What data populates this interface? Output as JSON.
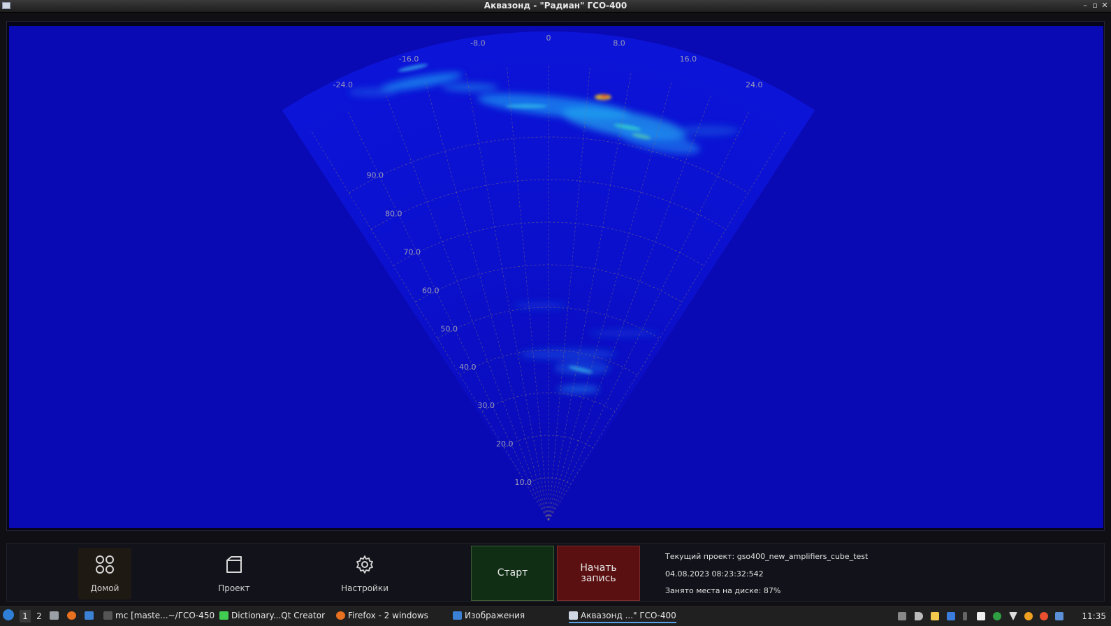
{
  "window": {
    "title": "Аквазонд  - \"Радиан\" ГСО-400"
  },
  "sonar": {
    "bearing_labels": [
      "-24.0",
      "-16.0",
      "-8.0",
      "0",
      "8.0",
      "16.0",
      "24.0"
    ],
    "range_labels": [
      "10.0",
      "20.0",
      "30.0",
      "40.0",
      "50.0",
      "60.0",
      "70.0",
      "80.0",
      "90.0"
    ],
    "colors": {
      "background": "#0a0ab4",
      "sector": "#0b10d0",
      "grid": "#8a7a6a"
    }
  },
  "nav": {
    "home": "Домой",
    "project": "Проект",
    "settings": "Настройки"
  },
  "actions": {
    "start": "Старт",
    "record_line1": "Начать",
    "record_line2": "запись"
  },
  "status": {
    "project": "Текущий проект: gso400_new_amplifiers_cube_test",
    "datetime": "04.08.2023  08:23:32:542",
    "disk": "Занято места на диске: 87%"
  },
  "taskbar": {
    "workspace_1": "1",
    "workspace_2": "2",
    "task_mc": "mc [maste...~/ГСО-450",
    "task_qt": "Dictionary...Qt Creator",
    "task_firefox": "Firefox - 2 windows",
    "task_images": "Изображения",
    "task_akvazond": "Аквазонд ...\" ГСО-400",
    "clock": "11:35"
  }
}
